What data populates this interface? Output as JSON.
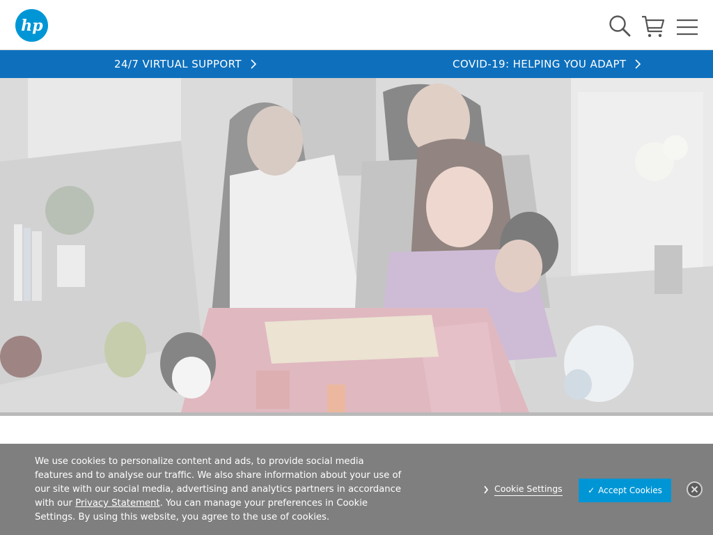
{
  "header": {
    "logo_text": "hp",
    "icons": [
      "search-icon",
      "cart-icon",
      "menu-icon"
    ]
  },
  "promo_bar": {
    "links": [
      {
        "label": "24/7 VIRTUAL SUPPORT"
      },
      {
        "label": "COVID-19: HELPING YOU ADAPT"
      }
    ]
  },
  "hero": {
    "image_alt": ""
  },
  "cookie_banner": {
    "text_before_link": "We use cookies to personalize content and ads, to provide social media features and to analyse our traffic. We also share information about your use of our site with our social media, advertising and analytics partners in accordance with our ",
    "privacy_link": "Privacy Statement",
    "text_after_link": ". You can manage your preferences in Cookie Settings. By using this website, you agree to the use of cookies.",
    "settings_label": "Cookie Settings",
    "accept_label": "Accept Cookies",
    "accept_check": "✓"
  },
  "colors": {
    "brand": "#0096d6",
    "promo_bar": "#0e70bd",
    "cookie_bg": "#7f7f7f"
  }
}
